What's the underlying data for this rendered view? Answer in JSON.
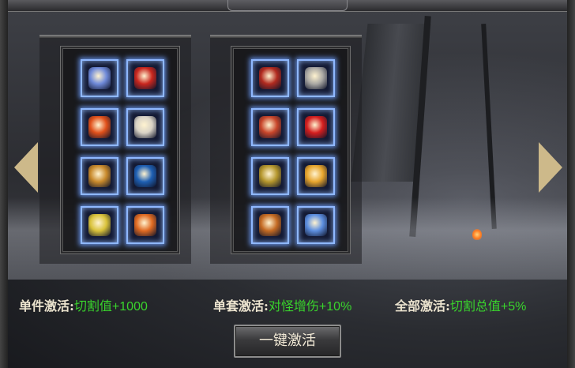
{
  "title": "",
  "colors": {
    "label": "#ece4cf",
    "value": "#39d42c",
    "slot_glow": "#8fb8ff",
    "arrow": "#cdb98a"
  },
  "left_set": {
    "items": [
      {
        "icon": "blue-blade-icon",
        "color": "#6f8ad9"
      },
      {
        "icon": "red-wings-icon",
        "color": "#c9261e"
      },
      {
        "icon": "flame-beast-icon",
        "color": "#e0501a"
      },
      {
        "icon": "silver-necklace-icon",
        "color": "#d8d2c6"
      },
      {
        "icon": "gold-ring-icon",
        "color": "#c8892b"
      },
      {
        "icon": "blue-orb-icon",
        "color": "#1e5fb3"
      },
      {
        "icon": "gold-shield-icon",
        "color": "#d9c23a"
      },
      {
        "icon": "fire-spirit-icon",
        "color": "#e06a22"
      }
    ]
  },
  "right_set": {
    "items": [
      {
        "icon": "red-sword-icon",
        "color": "#b12a1f"
      },
      {
        "icon": "silver-armor-icon",
        "color": "#aaa8a4"
      },
      {
        "icon": "crimson-star-icon",
        "color": "#c8452a"
      },
      {
        "icon": "red-flame-orb-icon",
        "color": "#d41e1e"
      },
      {
        "icon": "gold-gauntlet-icon",
        "color": "#b4962c"
      },
      {
        "icon": "gold-emblem-icon",
        "color": "#e7a52d"
      },
      {
        "icon": "demon-helm-icon",
        "color": "#c46a22"
      },
      {
        "icon": "blue-lantern-icon",
        "color": "#5c8ee0"
      }
    ]
  },
  "bonuses": [
    {
      "label": "单件激活:",
      "value": "切割值+1000"
    },
    {
      "label": "单套激活:",
      "value": "对怪增伤+10%"
    },
    {
      "label": "全部激活:",
      "value": "切割总值+5%"
    }
  ],
  "activate_button": "一键激活"
}
